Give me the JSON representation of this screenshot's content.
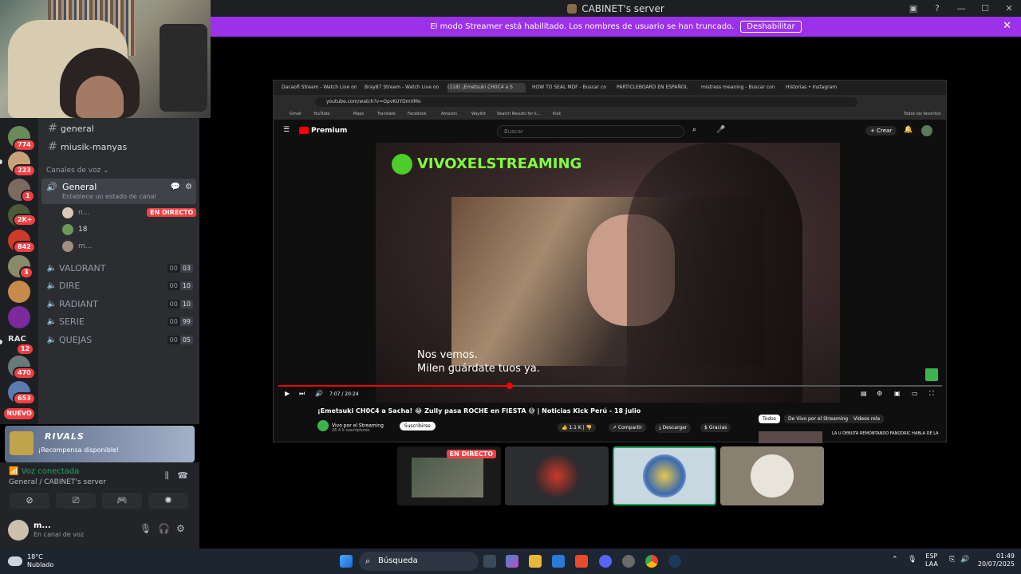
{
  "window": {
    "title": "CABINET's server"
  },
  "banner": {
    "text": "El modo Streamer está habilitado. Los nombres de usuario se han truncado.",
    "button": "Deshabilitar"
  },
  "servers": [
    {
      "badge": "774"
    },
    {
      "badge": "223"
    },
    {
      "badge": "1"
    },
    {
      "badge": "2K+"
    },
    {
      "badge": "842"
    },
    {
      "badge": "3"
    },
    {
      "badge": ""
    },
    {
      "badge": ""
    },
    {
      "badge": "12",
      "label": "RAC"
    },
    {
      "badge": "470"
    },
    {
      "badge": "653"
    }
  ],
  "new_label": "NUEVO",
  "channels": {
    "text": [
      {
        "name": "general"
      },
      {
        "name": "miusik-manyas"
      }
    ],
    "voice_category": "Canales de voz",
    "general": {
      "name": "General",
      "status": "Establece un estado de canal"
    },
    "voice_users": [
      {
        "name": "n..."
      },
      {
        "name": "18"
      },
      {
        "name": "m..."
      }
    ],
    "live_label": "EN DIRECTO",
    "voice": [
      {
        "name": "VALORANT",
        "a": "00",
        "b": "03"
      },
      {
        "name": "DIRE",
        "a": "00",
        "b": "10"
      },
      {
        "name": "RADIANT",
        "a": "00",
        "b": "10"
      },
      {
        "name": "SERIE",
        "a": "00",
        "b": "99"
      },
      {
        "name": "QUEJAS",
        "a": "00",
        "b": "05"
      }
    ]
  },
  "promo": {
    "logo": "RIVALS",
    "text": "¡Recompensa disponible!"
  },
  "voice_status": {
    "state": "Voz conectada",
    "location": "General / CABINET's server"
  },
  "user": {
    "name": "m...",
    "status": "En canal de voz"
  },
  "stream": {
    "tabs": [
      "Dacaofi Stream - Watch Live on",
      "Bray87 Stream - Watch Live on",
      "(118) ¡Emetsuki CH0C4 a S",
      "HOW TO SEAL MDF - Buscar co",
      "PARTICLEBOARD EN ESPAÑOL",
      "mistress meaning - Buscar con",
      "Historias • Instagram"
    ],
    "url": "youtube.com/watch?v=OpvKUYDmVMo",
    "bookmarks": [
      "Gmail",
      "YouTube",
      "Maps",
      "Translate",
      "Facebook",
      "Amazon",
      "Waylist",
      "Search Results for k...",
      "Kick"
    ],
    "bookmarks_right": "Todos los favoritos",
    "yt_logo": "Premium",
    "search_placeholder": "Buscar",
    "create": "Crear",
    "brand": "VIVOXELSTREAMING",
    "subtitle1": "Nos vemos.",
    "subtitle2": "Milen guárdate tuos ya.",
    "time": "7:07 / 20:24",
    "progress": 0.349,
    "video_title": "¡Emetsuki CH0C4 a Sacha! 😂 Zully pasa ROCHE en FIESTA 😅 | Noticias Kick Perú - 18 julio",
    "channel": "Vivo por el Streaming",
    "channel_subs": "26.4 k suscriptores",
    "subscribe": "Suscribirse",
    "likes": "1.1 K",
    "share": "Compartir",
    "download": "Descargar",
    "thanks": "Gracias",
    "chips": [
      "Todos",
      "De Vivo por el Streaming",
      "Videos rela"
    ],
    "rec_title": "LA U DEBUTA REMONTANDO FANODRIC HABLA DE LA"
  },
  "thumbs": {
    "live_label": "EN DIRECTO"
  },
  "taskbar": {
    "weather_temp": "18°C",
    "weather_desc": "Nublado",
    "search": "Búsqueda",
    "lang1": "ESP",
    "lang2": "LAA",
    "time": "01:49",
    "date": "20/07/2025"
  }
}
